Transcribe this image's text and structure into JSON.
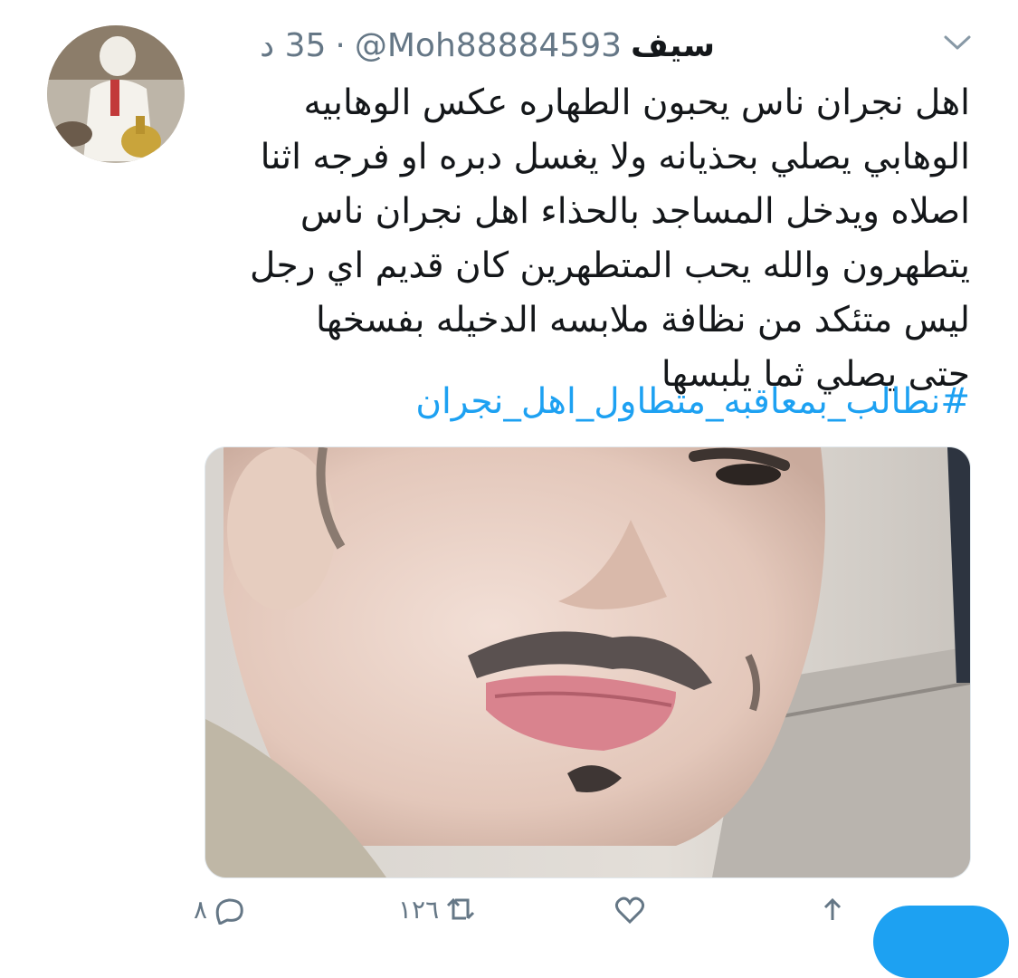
{
  "tweet": {
    "display_name": "سيف",
    "handle": "@Moh88884593",
    "separator": "·",
    "timestamp": "35 د",
    "text_lines": "اهل نجران ناس يحبون الطهاره  عكس  الوهابيه\nالوهابي يصلي بحذيانه ولا يغسل دبره او فرجه اثنا\nاصلاه ويدخل المساجد بالحذاء  اهل نجران ناس\nيتطهرون والله يحب المتطهرين كان قديم اي رجل\nليس متئكد من نظافة ملابسه الدخيله بفسخها\nحتى يصلي ثما يلبسها",
    "hashtag": "#نطالب_بمعاقبه_متطاول_اهل_نجران"
  },
  "actions": {
    "reply_count": "٨",
    "retweet_count": "١٢٦",
    "like_count": "",
    "icons": [
      "reply-icon",
      "retweet-icon",
      "like-icon",
      "share-icon"
    ]
  },
  "colors": {
    "link": "#1da1f2",
    "muted": "#657786",
    "text": "#14171a"
  }
}
